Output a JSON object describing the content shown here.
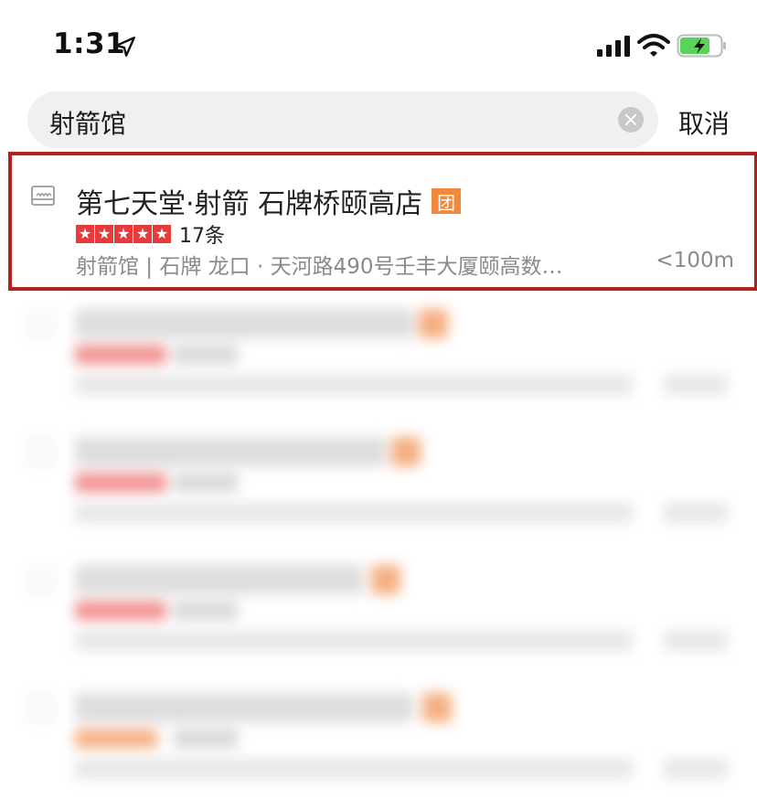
{
  "status_bar": {
    "time": "1:31",
    "icons": [
      "location-arrow-icon",
      "cellular-signal-icon",
      "wifi-icon",
      "battery-charging-icon"
    ],
    "battery_color": "#5ad35a"
  },
  "search": {
    "query": "射箭馆",
    "cancel_label": "取消"
  },
  "results": [
    {
      "title": "第七天堂·射箭 石牌桥颐高店",
      "tag": "团",
      "stars": 5,
      "review_count": "17条",
      "address": "射箭馆 | 石牌 龙口 · 天河路490号壬丰大厦颐高数…",
      "distance": "<100m"
    }
  ],
  "colors": {
    "highlight_border": "#b0221b",
    "tag": "#f0883e",
    "stars": "#e63b3b"
  }
}
